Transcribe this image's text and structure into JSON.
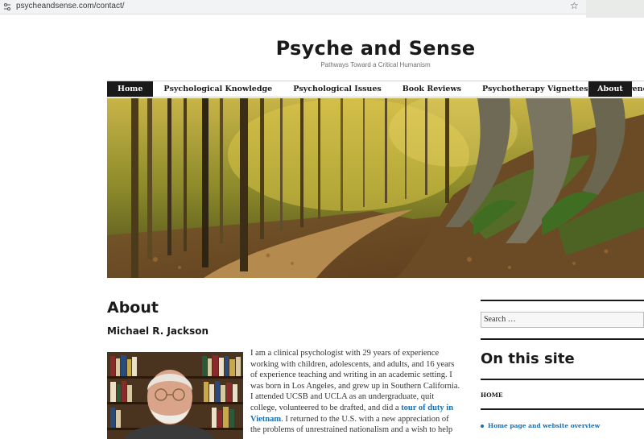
{
  "browser": {
    "url": "psycheandsense.com/contact/",
    "star_icon": "star-icon",
    "tune_icon": "site-settings-icon"
  },
  "site": {
    "title": "Psyche and Sense",
    "tagline": "Pathways Toward a Critical Humanism"
  },
  "nav": {
    "items": [
      {
        "label": "Home",
        "active": true
      },
      {
        "label": "Psychological Knowledge",
        "active": false
      },
      {
        "label": "Psychological Issues",
        "active": false
      },
      {
        "label": "Book Reviews",
        "active": false
      },
      {
        "label": "Psychotherapy Vignettes",
        "active": false
      },
      {
        "label": "References",
        "active": false
      },
      {
        "label": "About",
        "active": true
      }
    ]
  },
  "content": {
    "page_title": "About",
    "author": "Michael R. Jackson",
    "bio_before_link": "I am a clinical psychologist with 29 years of experience working with children, adolescents, and adults, and 16 years of experience teaching and writing in an academic setting.  I was born in Los Angeles, and grew up in Southern California. I attended UCSB and UCLA as an undergraduate, quit college, volunteered to be drafted, and did a ",
    "bio_link": "tour of duty in Vietnam",
    "bio_after_link": ". I returned to the U.S. with a new appreciation of the problems of unrestrained nationalism and a wish to help"
  },
  "sidebar": {
    "search_placeholder": "Search …",
    "widget_title": "On this site",
    "home_label": "HOME",
    "list": [
      "Home page and website overview"
    ]
  },
  "colors": {
    "accent_dark": "#1a1a1a",
    "link": "#1a6fb0",
    "text": "#333333"
  }
}
